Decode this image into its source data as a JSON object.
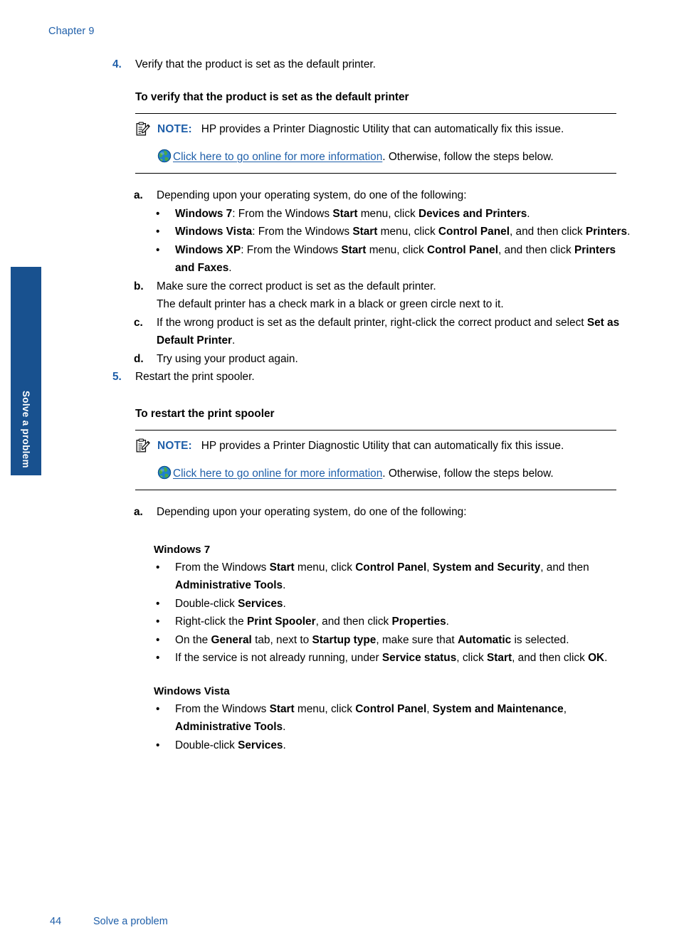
{
  "page": {
    "chapter_head": "Chapter 9",
    "side_tab_label": "Solve a problem",
    "footer_page_number": "44",
    "footer_title": "Solve a problem",
    "accent_blue": "#1f5fa9",
    "tab_blue": "#18518f"
  },
  "note_common": {
    "label": "NOTE:",
    "body": "HP provides a Printer Diagnostic Utility that can automatically fix this issue.",
    "link_text": "Click here to go online for more information",
    "after_link": ". Otherwise, follow the steps below.",
    "icon": "note-clipboard-icon",
    "link_icon": "globe-icon"
  },
  "step4": {
    "marker": "4.",
    "text": "Verify that the product is set as the default printer.",
    "procedure_heading": "To verify that the product is set as the default printer",
    "a": {
      "marker": "a.",
      "text": "Depending upon your operating system, do one of the following:",
      "bullets": [
        {
          "dot": "•",
          "os": "Windows 7",
          "sep": ": From the Windows ",
          "b1": "Start",
          "mid": " menu, click ",
          "b2": "Devices and Printers",
          "tail": "."
        },
        {
          "dot": "•",
          "os": "Windows Vista",
          "sep": ": From the Windows ",
          "b1": "Start",
          "mid": " menu, click ",
          "b2": "Control Panel",
          "tail": ", and then click ",
          "b3": "Printers",
          "tail2": "."
        },
        {
          "dot": "•",
          "os": "Windows XP",
          "sep": ": From the Windows ",
          "b1": "Start",
          "mid": " menu, click ",
          "b2": "Control Panel",
          "tail": ", and then click ",
          "b3": "Printers and Faxes",
          "tail2": "."
        }
      ]
    },
    "b": {
      "marker": "b.",
      "text": "Make sure the correct product is set as the default printer.",
      "cont": "The default printer has a check mark in a black or green circle next to it."
    },
    "c": {
      "marker": "c.",
      "pre": "If the wrong product is set as the default printer, right-click the correct product and select ",
      "bold": "Set as Default Printer",
      "post": "."
    },
    "d": {
      "marker": "d.",
      "text": "Try using your product again."
    }
  },
  "step5": {
    "marker": "5.",
    "text": "Restart the print spooler.",
    "procedure_heading": "To restart the print spooler",
    "a": {
      "marker": "a.",
      "text": "Depending upon your operating system, do one of the following:"
    },
    "win7": {
      "heading": "Windows 7",
      "bullets": [
        {
          "dot": "•",
          "p1": "From the Windows ",
          "b1": "Start",
          "p2": " menu, click ",
          "b2": "Control Panel",
          "p3": ", ",
          "b3": "System and Security",
          "p4": ", and then ",
          "b4": "Administrative Tools",
          "p5": "."
        },
        {
          "dot": "•",
          "p1": "Double-click ",
          "b1": "Services",
          "p2": "."
        },
        {
          "dot": "•",
          "p1": "Right-click the ",
          "b1": "Print Spooler",
          "p2": ", and then click ",
          "b2": "Properties",
          "p3": "."
        },
        {
          "dot": "•",
          "p1": "On the ",
          "b1": "General",
          "p2": " tab, next to ",
          "b2": "Startup type",
          "p3": ", make sure that ",
          "b3": "Automatic",
          "p4": " is selected."
        },
        {
          "dot": "•",
          "p1": "If the service is not already running, under ",
          "b1": "Service status",
          "p2": ", click ",
          "b2": "Start",
          "p3": ", and then click ",
          "b3": "OK",
          "p4": "."
        }
      ]
    },
    "vista": {
      "heading": "Windows Vista",
      "bullets": [
        {
          "dot": "•",
          "p1": "From the Windows ",
          "b1": "Start",
          "p2": " menu, click ",
          "b2": "Control Panel",
          "p3": ", ",
          "b3": "System and Maintenance",
          "p4": ", ",
          "b4": "Administrative Tools",
          "p5": "."
        },
        {
          "dot": "•",
          "p1": "Double-click ",
          "b1": "Services",
          "p2": "."
        }
      ]
    }
  }
}
